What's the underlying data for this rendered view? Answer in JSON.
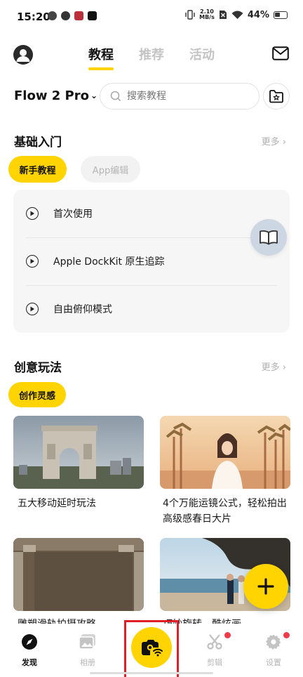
{
  "status_bar": {
    "time": "15:20",
    "net_speed_value": "2.10",
    "net_speed_unit": "MB/s",
    "battery": "44%"
  },
  "top_nav": {
    "tabs": [
      {
        "label": "教程",
        "active": true
      },
      {
        "label": "推荐",
        "active": false
      },
      {
        "label": "活动",
        "active": false
      }
    ]
  },
  "device_selector": {
    "label": "Flow 2 Pro"
  },
  "search": {
    "placeholder": "搜索教程"
  },
  "basics": {
    "title": "基础入门",
    "more": "更多",
    "chips": [
      {
        "label": "新手教程",
        "active": true
      },
      {
        "label": "App编辑",
        "active": false
      }
    ],
    "items": [
      {
        "label": "首次使用"
      },
      {
        "label": "Apple DockKit 原生追踪"
      },
      {
        "label": "自由俯仰模式"
      }
    ]
  },
  "creative": {
    "title": "创意玩法",
    "more": "更多",
    "chips": [
      {
        "label": "创作灵感",
        "active": true
      }
    ],
    "cards": [
      {
        "caption": "五大移动延时玩法"
      },
      {
        "caption": "4个万能运镜公式，轻松拍出高级感春日大片"
      },
      {
        "caption": "雕塑滑轨拍摄攻略"
      },
      {
        "caption": "巧妙旋转，酷炫画"
      }
    ]
  },
  "bottom_nav": {
    "items": [
      {
        "label": "发现",
        "active": true
      },
      {
        "label": "相册",
        "active": false
      },
      {
        "label": "剪辑",
        "active": false,
        "badge": true
      },
      {
        "label": "设置",
        "active": false,
        "badge": true
      }
    ]
  },
  "colors": {
    "accent": "#ffd400",
    "badge": "#f03a4a",
    "highlight_box": "#e01e25"
  }
}
